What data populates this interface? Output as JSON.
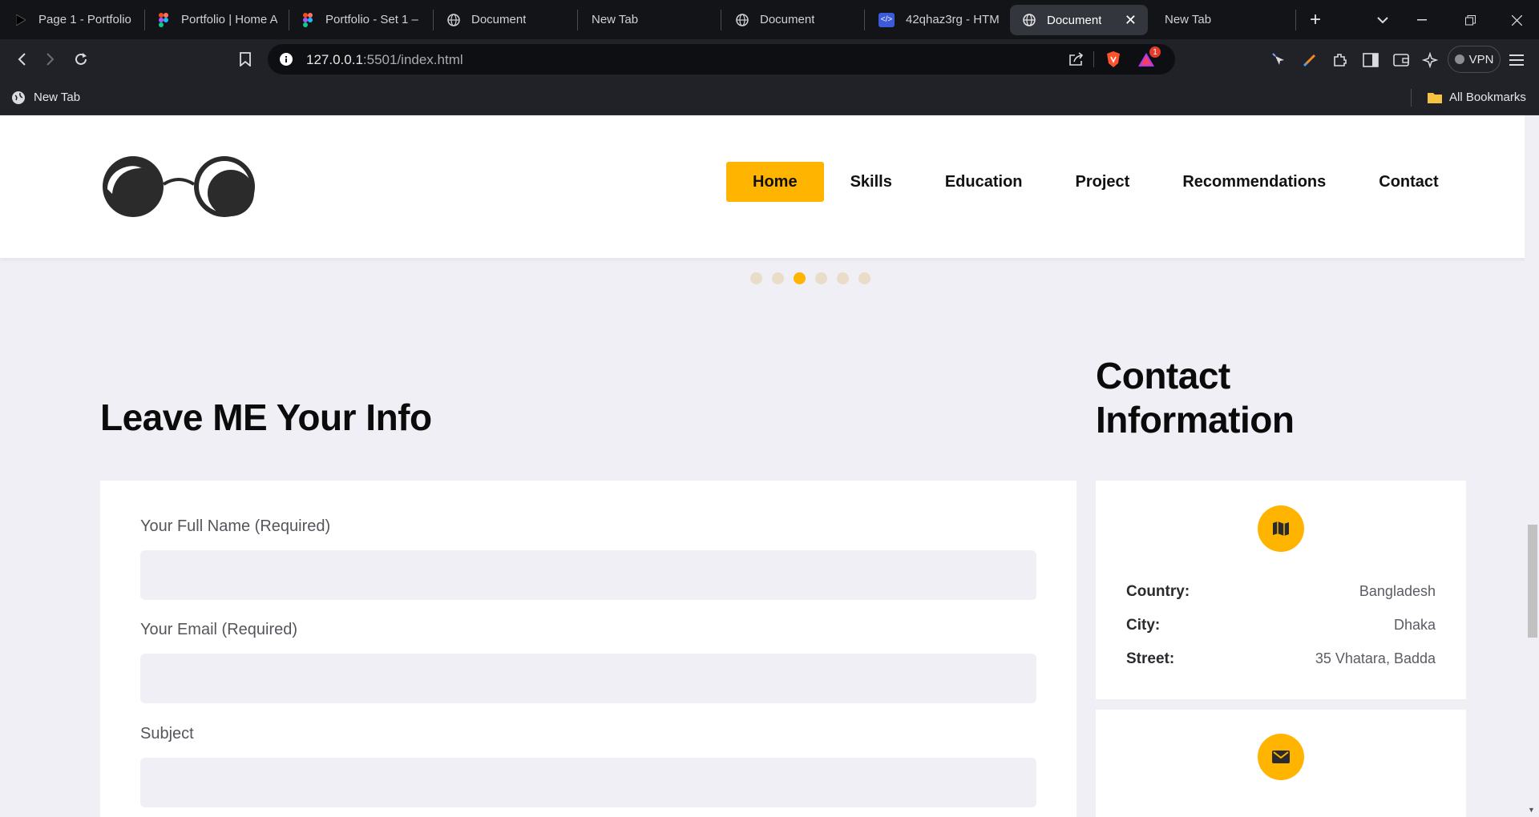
{
  "tabs": [
    {
      "title": "Page 1 - Portfolio",
      "icon": "figma-play-icon"
    },
    {
      "title": "Portfolio | Home A",
      "icon": "figma-icon"
    },
    {
      "title": "Portfolio - Set 1 –",
      "icon": "figma-icon"
    },
    {
      "title": "Document",
      "icon": "globe-icon"
    },
    {
      "title": "New Tab",
      "icon": ""
    },
    {
      "title": "Document",
      "icon": "globe-icon"
    },
    {
      "title": "42qhaz3rg - HTM",
      "icon": "code-icon"
    },
    {
      "title": "Document",
      "icon": "globe-icon",
      "active": true
    },
    {
      "title": "New Tab",
      "icon": ""
    }
  ],
  "browser": {
    "url_host": "127.0.0.1",
    "url_rest": ":5501/index.html",
    "vpn_label": "VPN",
    "new_tab_symbol": "+",
    "brave_badge_count": "1"
  },
  "bookmarks": {
    "left_item": "New Tab",
    "right_item": "All Bookmarks"
  },
  "nav": {
    "items": [
      "Home",
      "Skills",
      "Education",
      "Project",
      "Recommendations",
      "Contact"
    ],
    "active_index": 0
  },
  "slider": {
    "dots": 6,
    "active": 3
  },
  "form_section": {
    "heading": "Leave ME Your Info",
    "fields": [
      {
        "label": "Your Full Name (Required)",
        "value": ""
      },
      {
        "label": "Your Email (Required)",
        "value": ""
      },
      {
        "label": "Subject",
        "value": ""
      }
    ]
  },
  "contact_section": {
    "heading_line1": "Contact",
    "heading_line2": "Information",
    "address_card": {
      "icon": "map-icon",
      "rows": [
        {
          "key": "Country:",
          "value": "Bangladesh"
        },
        {
          "key": "City:",
          "value": "Dhaka"
        },
        {
          "key": "Street:",
          "value": "35 Vhatara, Badda"
        }
      ]
    },
    "email_card": {
      "icon": "envelope-icon"
    }
  },
  "colors": {
    "accent": "#ffb400",
    "page_bg": "#f0eff5",
    "card_bg": "#ffffff",
    "tabbar_bg": "#131417"
  }
}
